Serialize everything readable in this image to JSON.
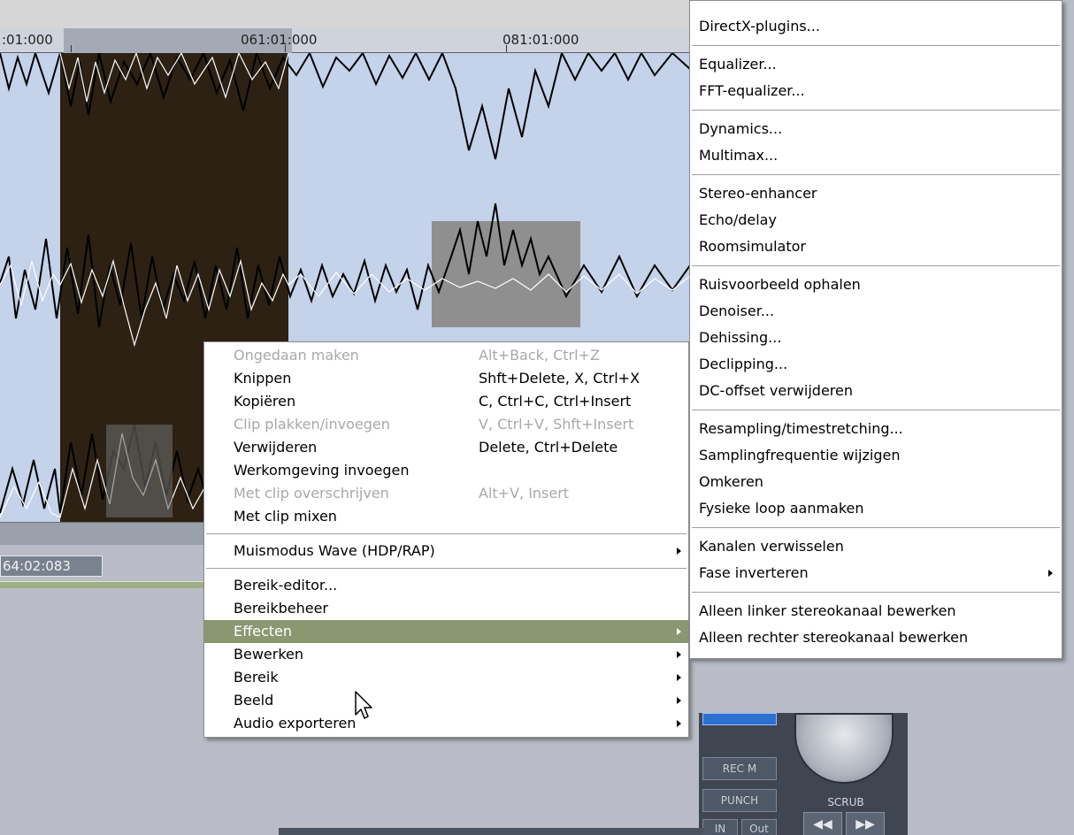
{
  "ruler": {
    "labels": [
      ":01:000",
      "061:01:000",
      "081:01:000"
    ]
  },
  "status": {
    "time": "64:02:083"
  },
  "transport": {
    "rec_label": "REC M",
    "punch_label": "PUNCH",
    "in_label": "IN",
    "out_label": "Out",
    "scrub_label": "SCRUB",
    "rewind_icon": "rewind-icon",
    "forward_icon": "fast-forward-icon"
  },
  "context_menu": {
    "items": [
      {
        "label": "Ongedaan maken",
        "shortcut": "Alt+Back, Ctrl+Z",
        "disabled": true
      },
      {
        "label": "Knippen",
        "shortcut": "Shft+Delete, X, Ctrl+X"
      },
      {
        "label": "Kopiëren",
        "shortcut": "C, Ctrl+C, Ctrl+Insert"
      },
      {
        "label": "Clip plakken/invoegen",
        "shortcut": "V, Ctrl+V, Shft+Insert",
        "disabled": true
      },
      {
        "label": "Verwijderen",
        "shortcut": "Delete, Ctrl+Delete"
      },
      {
        "label": "Werkomgeving invoegen",
        "shortcut": ""
      },
      {
        "label": "Met clip overschrijven",
        "shortcut": "Alt+V, Insert",
        "disabled": true
      },
      {
        "label": "Met clip mixen",
        "shortcut": ""
      },
      {
        "label": "Muismodus Wave (HDP/RAP)",
        "submenu": true
      },
      {
        "label": "Bereik-editor..."
      },
      {
        "label": "Bereikbeheer"
      },
      {
        "label": "Effecten",
        "submenu": true,
        "highlighted": true
      },
      {
        "label": "Bewerken",
        "submenu": true
      },
      {
        "label": "Bereik",
        "submenu": true
      },
      {
        "label": "Beeld",
        "submenu": true
      },
      {
        "label": "Audio exporteren",
        "submenu": true
      }
    ]
  },
  "effects_menu": {
    "items": [
      "DirectX-plugins...",
      "Equalizer...",
      "FFT-equalizer...",
      "Dynamics...",
      "Multimax...",
      "Stereo-enhancer",
      "Echo/delay",
      "Roomsimulator",
      "Ruisvoorbeeld ophalen",
      "Denoiser...",
      "Dehissing...",
      "Declipping...",
      "DC-offset verwijderen",
      "Resampling/timestretching...",
      "Samplingfrequentie wijzigen",
      "Omkeren",
      "Fysieke loop aanmaken",
      "Kanalen verwisselen",
      "Fase inverteren",
      "Alleen linker stereokanaal bewerken",
      "Alleen rechter stereokanaal bewerken"
    ]
  }
}
